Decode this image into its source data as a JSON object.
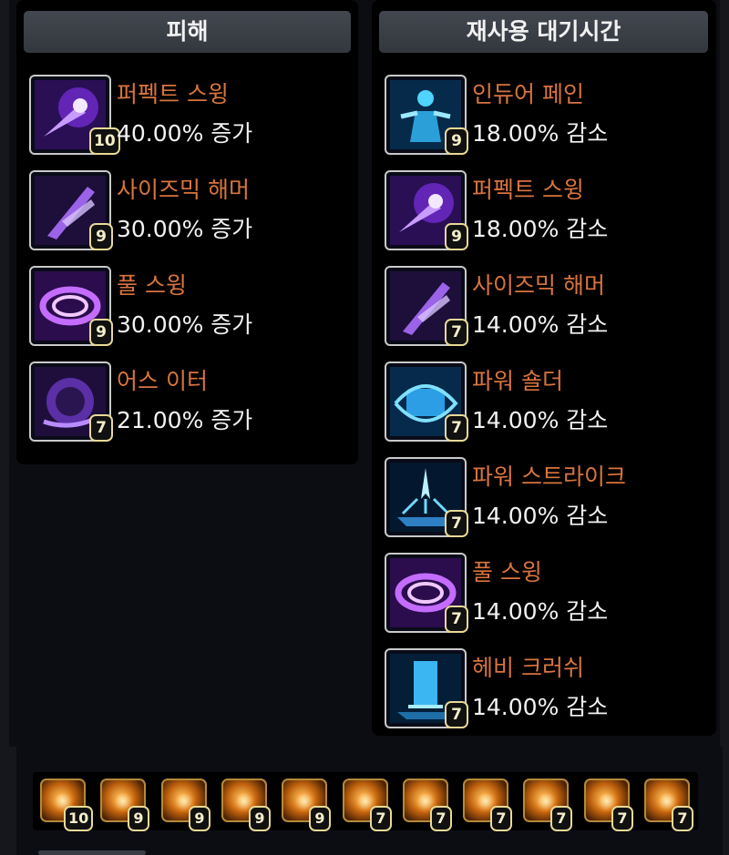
{
  "damage_panel": {
    "title": "피해",
    "items": [
      {
        "name": "퍼펙트 스윙",
        "value": "40.00% 증가",
        "level": "10",
        "icon": "perfect-swing-icon"
      },
      {
        "name": "사이즈믹 해머",
        "value": "30.00% 증가",
        "level": "9",
        "icon": "seismic-hammer-icon"
      },
      {
        "name": "풀 스윙",
        "value": "30.00% 증가",
        "level": "9",
        "icon": "full-swing-icon"
      },
      {
        "name": "어스 이터",
        "value": "21.00% 증가",
        "level": "7",
        "icon": "earth-eater-icon"
      }
    ]
  },
  "cooldown_panel": {
    "title": "재사용 대기시간",
    "items": [
      {
        "name": "인듀어 페인",
        "value": "18.00% 감소",
        "level": "9",
        "icon": "endure-pain-icon"
      },
      {
        "name": "퍼펙트 스윙",
        "value": "18.00% 감소",
        "level": "9",
        "icon": "perfect-swing-icon"
      },
      {
        "name": "사이즈믹 해머",
        "value": "14.00% 감소",
        "level": "7",
        "icon": "seismic-hammer-icon"
      },
      {
        "name": "파워 숄더",
        "value": "14.00% 감소",
        "level": "7",
        "icon": "power-shoulder-icon"
      },
      {
        "name": "파워 스트라이크",
        "value": "14.00% 감소",
        "level": "7",
        "icon": "power-strike-icon"
      },
      {
        "name": "풀 스윙",
        "value": "14.00% 감소",
        "level": "7",
        "icon": "full-swing-icon"
      },
      {
        "name": "헤비 크러쉬",
        "value": "14.00% 감소",
        "level": "7",
        "icon": "heavy-crush-icon"
      }
    ]
  },
  "gems": [
    "10",
    "9",
    "9",
    "9",
    "9",
    "7",
    "7",
    "7",
    "7",
    "7",
    "7"
  ],
  "colors": {
    "skill_name": "#d9743e",
    "value_text": "#f2f2f2",
    "level_border": "#e8d996"
  }
}
